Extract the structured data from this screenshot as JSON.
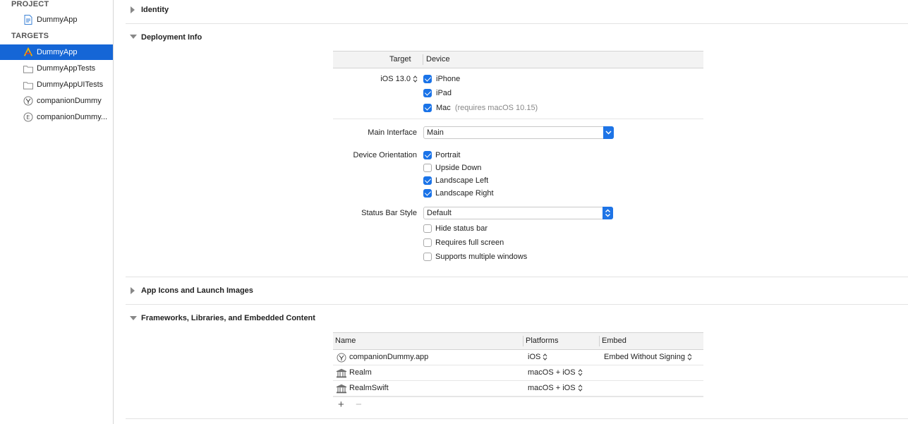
{
  "sidebar": {
    "project_header": "PROJECT",
    "project_item": {
      "label": "DummyApp",
      "icon": "project-file-icon"
    },
    "targets_header": "TARGETS",
    "targets": [
      {
        "label": "DummyApp",
        "icon": "app-target-icon",
        "selected": true
      },
      {
        "label": "DummyAppTests",
        "icon": "folder-icon",
        "selected": false
      },
      {
        "label": "DummyAppUITests",
        "icon": "folder-icon",
        "selected": false
      },
      {
        "label": "companionDummy",
        "icon": "watch-app-icon",
        "selected": false
      },
      {
        "label": "companionDummy...",
        "icon": "extension-icon",
        "selected": false
      }
    ]
  },
  "sections": {
    "identity": "Identity",
    "deployment": "Deployment Info",
    "app_icons": "App Icons and Launch Images",
    "frameworks": "Frameworks, Libraries, and Embedded Content"
  },
  "deployment": {
    "col_target": "Target",
    "col_device": "Device",
    "ios_version": "iOS 13.0",
    "devices": [
      {
        "label": "iPhone",
        "checked": true,
        "note": ""
      },
      {
        "label": "iPad",
        "checked": true,
        "note": ""
      },
      {
        "label": "Mac",
        "checked": true,
        "note": "(requires macOS 10.15)"
      }
    ],
    "main_interface_label": "Main Interface",
    "main_interface_value": "Main",
    "orientation_label": "Device Orientation",
    "orientations": [
      {
        "label": "Portrait",
        "checked": true
      },
      {
        "label": "Upside Down",
        "checked": false
      },
      {
        "label": "Landscape Left",
        "checked": true
      },
      {
        "label": "Landscape Right",
        "checked": true
      }
    ],
    "status_bar_label": "Status Bar Style",
    "status_bar_value": "Default",
    "status_options": [
      {
        "label": "Hide status bar",
        "checked": false
      },
      {
        "label": "Requires full screen",
        "checked": false
      },
      {
        "label": "Supports multiple windows",
        "checked": false
      }
    ]
  },
  "frameworks": {
    "col_name": "Name",
    "col_platforms": "Platforms",
    "col_embed": "Embed",
    "rows": [
      {
        "name": "companionDummy.app",
        "icon": "watch-app-icon",
        "platforms": "iOS",
        "embed": "Embed Without Signing"
      },
      {
        "name": "Realm",
        "icon": "framework-icon",
        "platforms": "macOS + iOS",
        "embed": ""
      },
      {
        "name": "RealmSwift",
        "icon": "framework-icon",
        "platforms": "macOS + iOS",
        "embed": ""
      }
    ],
    "add_symbol": "+",
    "remove_symbol": "−"
  },
  "colors": {
    "selection": "#1566d6",
    "checkbox": "#1a73e8",
    "popup_arrow": "#1e74e6"
  }
}
